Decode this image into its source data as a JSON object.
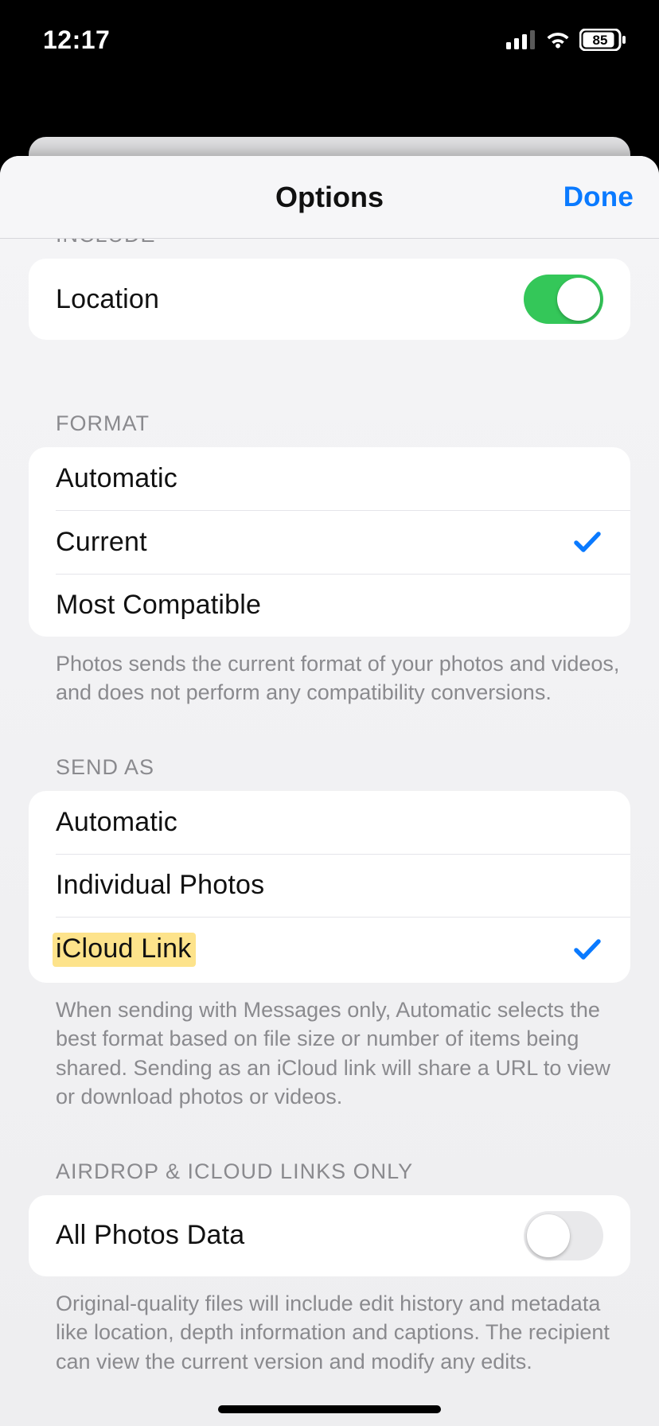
{
  "status": {
    "time": "12:17",
    "battery_percent": "85"
  },
  "navbar": {
    "title": "Options",
    "done": "Done"
  },
  "sections": {
    "include": {
      "header": "INCLUDE",
      "location_label": "Location",
      "location_on": true
    },
    "format": {
      "header": "FORMAT",
      "options": [
        {
          "label": "Automatic",
          "selected": false
        },
        {
          "label": "Current",
          "selected": true
        },
        {
          "label": "Most Compatible",
          "selected": false
        }
      ],
      "footer": "Photos sends the current format of your photos and videos, and does not perform any compatibility conversions."
    },
    "send_as": {
      "header": "SEND AS",
      "options": [
        {
          "label": "Automatic",
          "selected": false
        },
        {
          "label": "Individual Photos",
          "selected": false
        },
        {
          "label": "iCloud Link",
          "selected": true,
          "highlighted": true
        }
      ],
      "footer": "When sending with Messages only, Automatic selects the best format based on file size or number of items being shared. Sending as an iCloud link will share a URL to view or download photos or videos."
    },
    "airdrop": {
      "header": "AIRDROP & ICLOUD LINKS ONLY",
      "all_photos_label": "All Photos Data",
      "all_photos_on": false,
      "footer": "Original-quality files will include edit history and metadata like location, depth information and captions. The recipient can view the current version and modify any edits."
    }
  }
}
